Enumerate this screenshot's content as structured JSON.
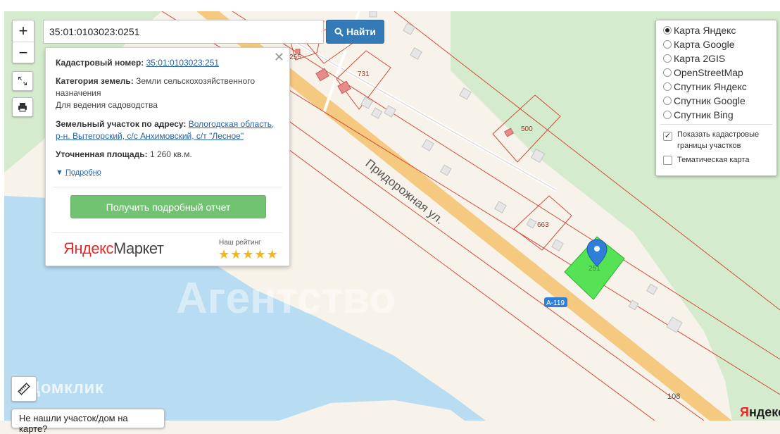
{
  "map": {
    "street_label": "Придорожная ул.",
    "highway_badge": "A-119",
    "km_marker": "108",
    "parcels": [
      {
        "number": "731"
      },
      {
        "number": "500"
      },
      {
        "number": "663"
      },
      {
        "number": "251"
      },
      {
        "number": "255"
      }
    ],
    "watermark_text": "Агентство",
    "colors": {
      "water": "#b8dcf2",
      "land": "#f7f3ea",
      "forest": "#d4eccd",
      "road": "#f6c980",
      "cadastral_border": "#d24a3a",
      "selected_parcel": "#55e355",
      "marker": "#2f7fd8"
    }
  },
  "controls": {
    "zoom_in": "+",
    "zoom_out": "−"
  },
  "search": {
    "value": "35:01:0103023:0251",
    "button_label": "Найти"
  },
  "popup": {
    "cadastral_label": "Кадастровый номер:",
    "cadastral_value": "35:01:0103023:251",
    "category_label": "Категория земель:",
    "category_value": "Земли сельскохозяйственного назначения",
    "usage_value": "Для ведения садоводства",
    "address_label": "Земельный участок по адресу:",
    "address_line1": "Вологодская область,",
    "address_line2": "р-н. Вытегорский, с/с Анхимовский, с/т \"Лесное\"",
    "area_label": "Уточненная площадь:",
    "area_value": "1 260 кв.м.",
    "more_link": "Подробно",
    "report_button": "Получить подробный отчет",
    "market_logo_left": "Яндекс",
    "market_logo_right": "Маркет",
    "rating_label": "Наш рейтинг",
    "rating_value": 5,
    "rating_max": 5
  },
  "layers": {
    "options": [
      {
        "label": "Карта Яндекс",
        "selected": true
      },
      {
        "label": "Карта Google",
        "selected": false
      },
      {
        "label": "Карта 2GIS",
        "selected": false
      },
      {
        "label": "OpenStreetMap",
        "selected": false
      },
      {
        "label": "Спутник Яндекс",
        "selected": false
      },
      {
        "label": "Спутник Google",
        "selected": false
      },
      {
        "label": "Спутник Bing",
        "selected": false
      }
    ],
    "show_borders_label": "Показать кадастровые границы участков",
    "show_borders_checked": true,
    "thematic_label": "Тематическая карта",
    "thematic_checked": false
  },
  "footer": {
    "domklik_logo": "Домклик",
    "not_found_text": "Не нашли участок/дом на карте?",
    "yandex_logo_first": "Я",
    "yandex_logo_rest": "ндекс"
  }
}
